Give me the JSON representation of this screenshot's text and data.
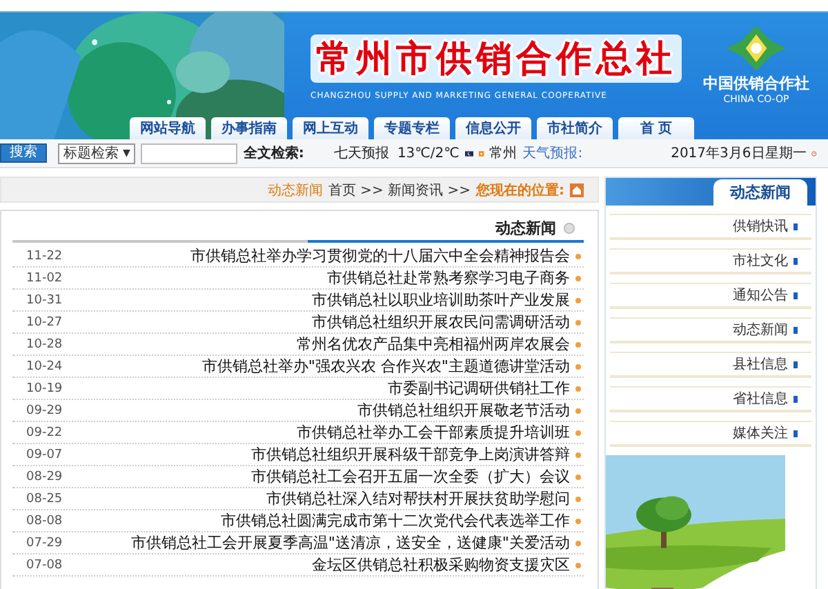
{
  "logo": {
    "name": "中国供销合作社",
    "sub": "CHINA CO-OP"
  },
  "header": {
    "title": "常州市供销合作总社",
    "subtitle": "CHANGZHOU SUPPLY AND MARKETING GENERAL COOPERATIVE"
  },
  "nav": [
    "网站导航",
    "办事指南",
    "网上互动",
    "专题专栏",
    "信息公开",
    "市社简介",
    "首 页"
  ],
  "info_bar": {
    "date": "2017年3月6日星期一",
    "weather_label": "天气预报:",
    "city": "常州",
    "temperature": "13℃/2℃",
    "forecast_link": "七天预报",
    "search_label": "全文检索:",
    "search_mode": "标题检索",
    "dropdown_arrow": "▼",
    "search_button": "搜索"
  },
  "sidebar": {
    "title": "动态新闻",
    "items": [
      "供销快讯",
      "市社文化",
      "通知公告",
      "动态新闻",
      "县社信息",
      "省社信息",
      "媒体关注"
    ]
  },
  "breadcrumb": {
    "label": "您现在的位置:",
    "path": "首页 >> 新闻资讯 >> ",
    "current": "动态新闻"
  },
  "panel": {
    "title": "动态新闻",
    "rows": [
      {
        "title": "市供销总社举办学习贯彻党的十八届六中全会精神报告会",
        "date": "11-22"
      },
      {
        "title": "市供销总社赴常熟考察学习电子商务",
        "date": "11-02"
      },
      {
        "title": "市供销总社以职业培训助茶叶产业发展",
        "date": "10-31"
      },
      {
        "title": "市供销总社组织开展农民问需调研活动",
        "date": "10-27"
      },
      {
        "title": "常州名优农产品集中亮相福州两岸农展会",
        "date": "10-28"
      },
      {
        "title": "市供销总社举办\"强农兴农 合作兴农\"主题道德讲堂活动",
        "date": "10-24"
      },
      {
        "title": "市委副书记调研供销社工作",
        "date": "10-19"
      },
      {
        "title": "市供销总社组织开展敬老节活动",
        "date": "09-29"
      },
      {
        "title": "市供销总社举办工会干部素质提升培训班",
        "date": "09-22"
      },
      {
        "title": "市供销总社组织开展科级干部竞争上岗演讲答辩",
        "date": "09-07"
      },
      {
        "title": "市供销总社工会召开五届一次全委（扩大）会议",
        "date": "08-29"
      },
      {
        "title": "市供销总社深入结对帮扶村开展扶贫助学慰问",
        "date": "08-25"
      },
      {
        "title": "市供销总社圆满完成市第十二次党代会代表选举工作",
        "date": "08-08"
      },
      {
        "title": "市供销总社工会开展夏季高温\"送清凉，送安全，送健康\"关爱活动",
        "date": "07-29"
      },
      {
        "title": "金坛区供销总社积极采购物资支援灾区",
        "date": "07-08"
      }
    ]
  }
}
